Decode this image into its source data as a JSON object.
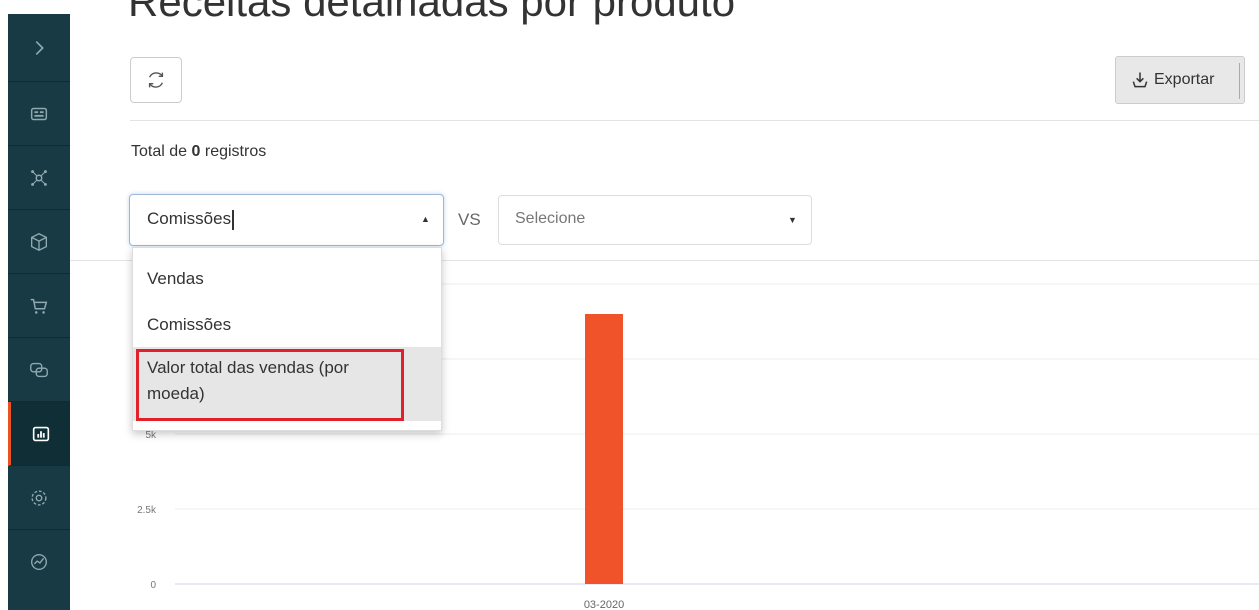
{
  "page": {
    "title": "Receitas detalhadas por produto"
  },
  "toolbar": {
    "export_label": "Exportar"
  },
  "summary": {
    "prefix": "Total de",
    "count": "0",
    "suffix": "registros"
  },
  "filters": {
    "metric_value": "Comissões",
    "vs_label": "VS",
    "compare_placeholder": "Selecione",
    "options": [
      "Vendas",
      "Comissões",
      "Valor total das vendas (por moeda)"
    ]
  },
  "sidebar": {
    "icons": [
      "chevron-right-icon",
      "dashboard-icon",
      "network-icon",
      "box-icon",
      "cart-icon",
      "chat-icon",
      "chart-icon",
      "gear-icon",
      "analytics-icon"
    ],
    "active_index": 6
  },
  "colors": {
    "bar": "#f0522a",
    "sidebar": "#173a44",
    "accent": "#e9531f",
    "highlight": "#e0202a"
  },
  "chart_data": {
    "type": "bar",
    "categories": [
      "03-2020"
    ],
    "values": [
      9000
    ],
    "y_tick_labels": [
      "0",
      "2.5k",
      "5k"
    ],
    "ylim": [
      0,
      10000
    ],
    "grid": true
  }
}
